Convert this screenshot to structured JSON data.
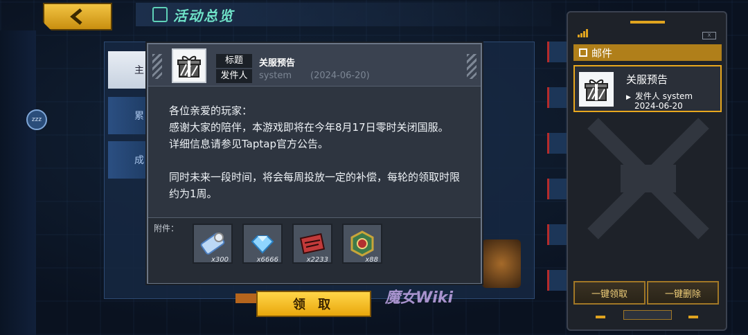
{
  "screen": {
    "title": "活动总览",
    "back_button_icon": "chevron-left-icon",
    "bg_tabs": [
      "主",
      "累",
      "成"
    ],
    "wiki_watermark": "魔女Wiki",
    "sleep_badge": "zzz"
  },
  "mail_detail": {
    "subject_label": "标题",
    "subject": "关服预告",
    "sender_label": "发件人",
    "sender": "system",
    "date": "(2024-06-20)",
    "body_lines": [
      "各位亲爱的玩家：",
      "感谢大家的陪伴，本游戏即将在今年8月17日零时关闭国服。",
      "详细信息请参见Taptap官方公告。",
      "",
      "同时未来一段时间，将会每周投放一定的补偿，每轮的领取时限约为1周。"
    ],
    "attachments_label": "附件：",
    "attachments": [
      {
        "icon": "ticket-icon",
        "qty": "x300"
      },
      {
        "icon": "diamond-icon",
        "qty": "x6666"
      },
      {
        "icon": "red-chip-icon",
        "qty": "x2233"
      },
      {
        "icon": "emblem-icon",
        "qty": "x88"
      }
    ],
    "claim_button": "领 取"
  },
  "mail_panel": {
    "header": "邮件",
    "battery": "X",
    "items": [
      {
        "subject": "关服预告",
        "from": "发件人 system",
        "date": "2024-06-20"
      }
    ],
    "claim_all_button": "一键领取",
    "delete_all_button": "一键删除"
  },
  "colors": {
    "accent_gold": "#e9a81e",
    "title_teal": "#6fe2c8",
    "dialog_bg": "#2e3540"
  }
}
